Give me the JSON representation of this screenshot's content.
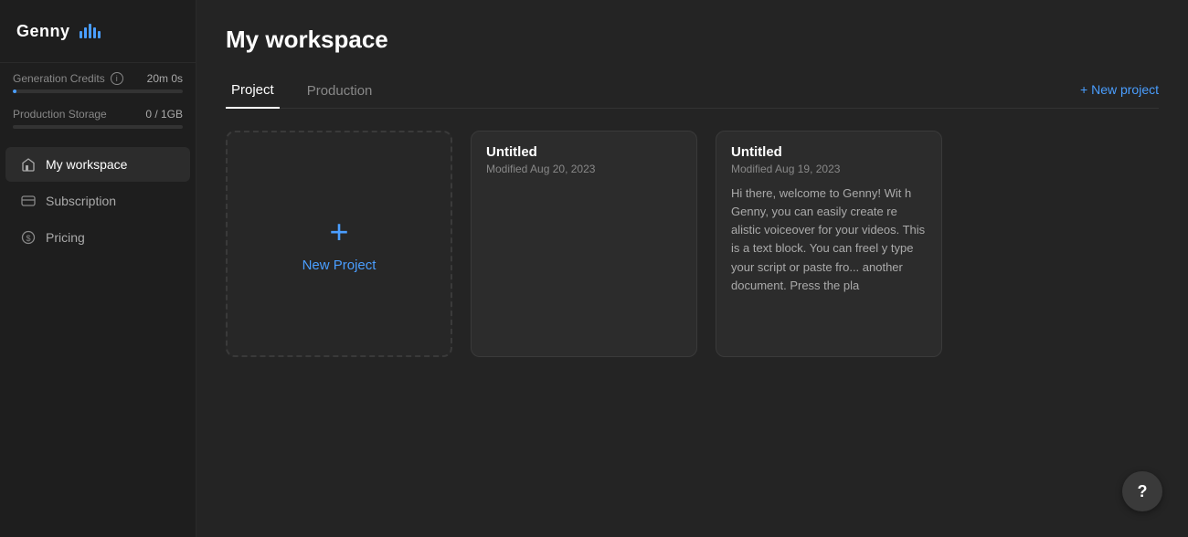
{
  "app": {
    "name": "Genny",
    "logo_bars": [
      3,
      5,
      7,
      5,
      3
    ]
  },
  "sidebar": {
    "credits": {
      "label": "Generation Credits",
      "value": "20m 0s",
      "progress_percent": 2
    },
    "storage": {
      "label": "Production Storage",
      "value": "0 / 1GB",
      "progress_percent": 0
    },
    "nav_items": [
      {
        "id": "workspace",
        "label": "My workspace",
        "icon": "home-icon",
        "active": true
      },
      {
        "id": "subscription",
        "label": "Subscription",
        "icon": "subscription-icon",
        "active": false
      },
      {
        "id": "pricing",
        "label": "Pricing",
        "icon": "pricing-icon",
        "active": false
      }
    ]
  },
  "main": {
    "title": "My workspace",
    "tabs": [
      {
        "id": "project",
        "label": "Project",
        "active": true
      },
      {
        "id": "production",
        "label": "Production",
        "active": false
      }
    ],
    "new_project_label": "+ New project",
    "new_project_card": {
      "plus": "+",
      "label": "New Project"
    },
    "projects": [
      {
        "id": "untitled-1",
        "title": "Untitled",
        "modified": "Modified Aug 20, 2023",
        "preview": ""
      },
      {
        "id": "untitled-2",
        "title": "Untitled",
        "modified": "Modified Aug 19, 2023",
        "preview": "Hi there, welcome to Genny! Wit h Genny, you can easily create re alistic voiceover for your videos. This is a text block. You can freel y type your script or paste fro... another document. Press the pla"
      }
    ]
  },
  "help": {
    "label": "?"
  }
}
